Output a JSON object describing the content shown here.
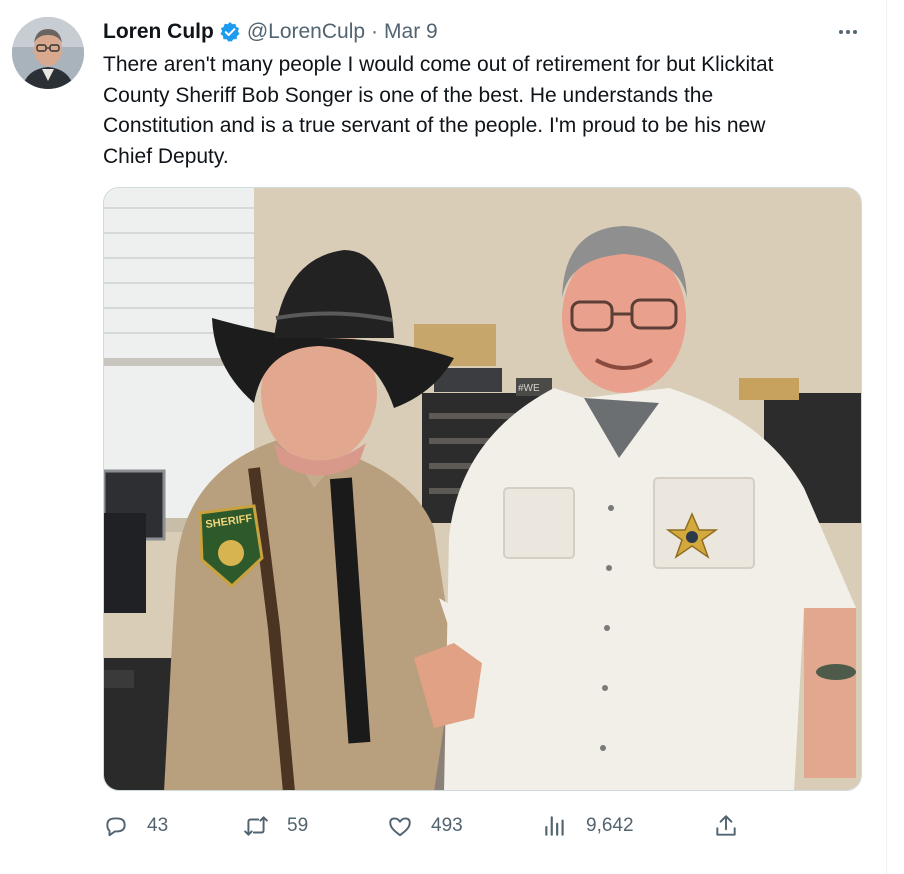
{
  "tweet": {
    "author": {
      "display_name": "Loren Culp",
      "handle": "@LorenCulp",
      "verified": true,
      "verified_color": "#1d9bf0"
    },
    "separator": "·",
    "date": "Mar 9",
    "text": "There aren't many people I would come out of retirement for but Klickitat\nCounty Sheriff Bob Songer is one of the best.  He understands the\nConstitution and is a true servant of the people. I'm proud to be his new\nChief Deputy.",
    "media": {
      "patch_text": "SHERIFF",
      "sign_text": "#WE"
    },
    "metrics": {
      "replies": "43",
      "reposts": "59",
      "likes": "493",
      "views": "9,642"
    },
    "icons": {
      "more": "more-icon",
      "reply": "reply-icon",
      "repost": "repost-icon",
      "like": "heart-icon",
      "views": "views-icon",
      "share": "share-icon"
    },
    "colors": {
      "text": "#0f1419",
      "secondary": "#536471",
      "border": "#cfd9de"
    }
  }
}
